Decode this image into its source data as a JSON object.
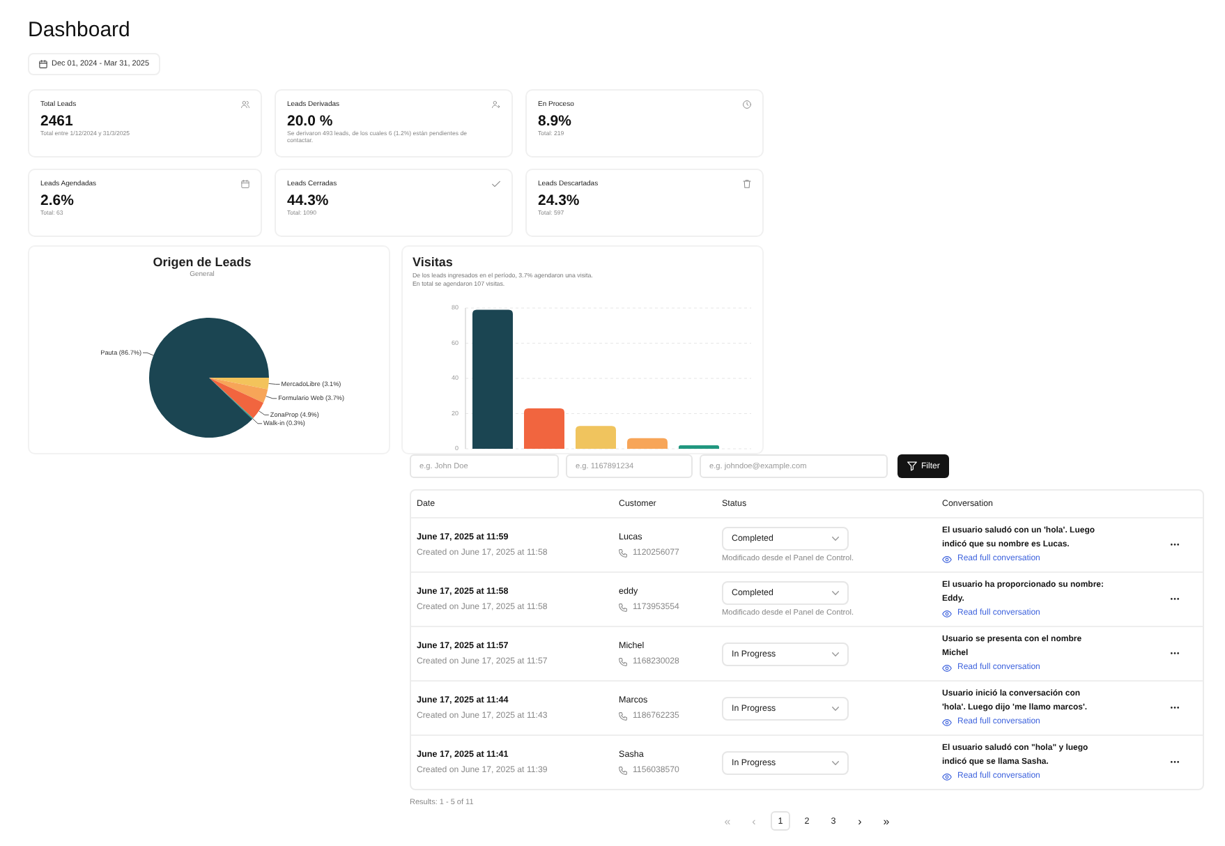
{
  "header": {
    "title": "Dashboard",
    "date_range": "Dec 01, 2024 - Mar 31, 2025"
  },
  "stat_cards": [
    {
      "label": "Total Leads",
      "value": "2461",
      "note": "Total entre 1/12/2024 y 31/3/2025"
    },
    {
      "label": "Leads Derivadas",
      "value": "20.0 %",
      "note": "Se derivaron 493 leads, de los cuales 6 (1.2%) están pendientes de contactar."
    },
    {
      "label": "En Proceso",
      "value": "8.9%",
      "note": "Total: 219"
    },
    {
      "label": "Leads Agendadas",
      "value": "2.6%",
      "note": "Total: 63"
    },
    {
      "label": "Leads Cerradas",
      "value": "44.3%",
      "note": "Total: 1090"
    },
    {
      "label": "Leads Descartadas",
      "value": "24.3%",
      "note": "Total: 597"
    }
  ],
  "origin_chart": {
    "title": "Origen de Leads",
    "subtitle": "General",
    "chart_data": {
      "type": "pie",
      "values": [
        86.7,
        3.1,
        3.7,
        4.9,
        0.3
      ],
      "value_labels": [
        "Pauta (86.7%)",
        "MercadoLibre (3.1%)",
        "Formulario Web (3.7%)",
        "ZonaProp (4.9%)",
        "Walk-in (0.3%)"
      ]
    }
  },
  "visits_chart": {
    "title": "Visitas",
    "description": [
      "De los leads ingresados en el período, 3.7% agendaron una visita.",
      "En total se agendaron 107 visitas."
    ],
    "chart_data": {
      "type": "bar",
      "values": [
        79,
        23,
        13,
        6,
        2
      ],
      "ylim": [
        0,
        80
      ],
      "yticks": [
        0,
        20,
        40,
        60,
        80
      ],
      "grid": true
    }
  },
  "filters": {
    "fields": [
      {
        "placeholder": "e.g. John Doe"
      },
      {
        "placeholder": "e.g. 1167891234"
      },
      {
        "placeholder": "e.g. johndoe@example.com"
      }
    ],
    "button": "Filter"
  },
  "table": {
    "columns": [
      "Date",
      "Customer",
      "Status",
      "Conversation"
    ],
    "rows": [
      {
        "date": "June 17, 2025 at 11:59",
        "created": "Created on June 17, 2025 at 11:58",
        "customer": "Lucas",
        "phone": "1120256077",
        "status": "Completed",
        "status_note": "Modificado desde el Panel de Control.",
        "conversation": "El usuario saludó con un 'hola'. Luego indicó que su nombre es Lucas.",
        "link": "Read full conversation"
      },
      {
        "date": "June 17, 2025 at 11:58",
        "created": "Created on June 17, 2025 at 11:58",
        "customer": "eddy",
        "phone": "1173953554",
        "status": "Completed",
        "status_note": "Modificado desde el Panel de Control.",
        "conversation": "El usuario ha proporcionado su nombre: Eddy.",
        "link": "Read full conversation"
      },
      {
        "date": "June 17, 2025 at 11:57",
        "created": "Created on June 17, 2025 at 11:57",
        "customer": "Michel",
        "phone": "1168230028",
        "status": "In Progress",
        "conversation": "Usuario se presenta con el nombre Michel",
        "link": "Read full conversation"
      },
      {
        "date": "June 17, 2025 at 11:44",
        "created": "Created on June 17, 2025 at 11:43",
        "customer": "Marcos",
        "phone": "1186762235",
        "status": "In Progress",
        "conversation": "Usuario inició la conversación con 'hola'. Luego dijo 'me llamo marcos'.",
        "link": "Read full conversation"
      },
      {
        "date": "June 17, 2025 at 11:41",
        "created": "Created on June 17, 2025 at 11:39",
        "customer": "Sasha",
        "phone": "1156038570",
        "status": "In Progress",
        "conversation": "El usuario saludó con \"hola\" y luego indicó que se llama Sasha.",
        "link": "Read full conversation"
      }
    ]
  },
  "results": "Results: 1 - 5 of 11",
  "pagination": {
    "first": {
      "label": "«",
      "disabled": true
    },
    "previous": {
      "label": "‹",
      "disabled": true
    },
    "pages": [
      {
        "label": "1",
        "selected": true
      },
      {
        "label": "2",
        "selected": false
      },
      {
        "label": "3",
        "selected": false
      }
    ],
    "next": {
      "label": "›",
      "disabled": false
    },
    "last": {
      "label": "»",
      "disabled": false
    }
  }
}
